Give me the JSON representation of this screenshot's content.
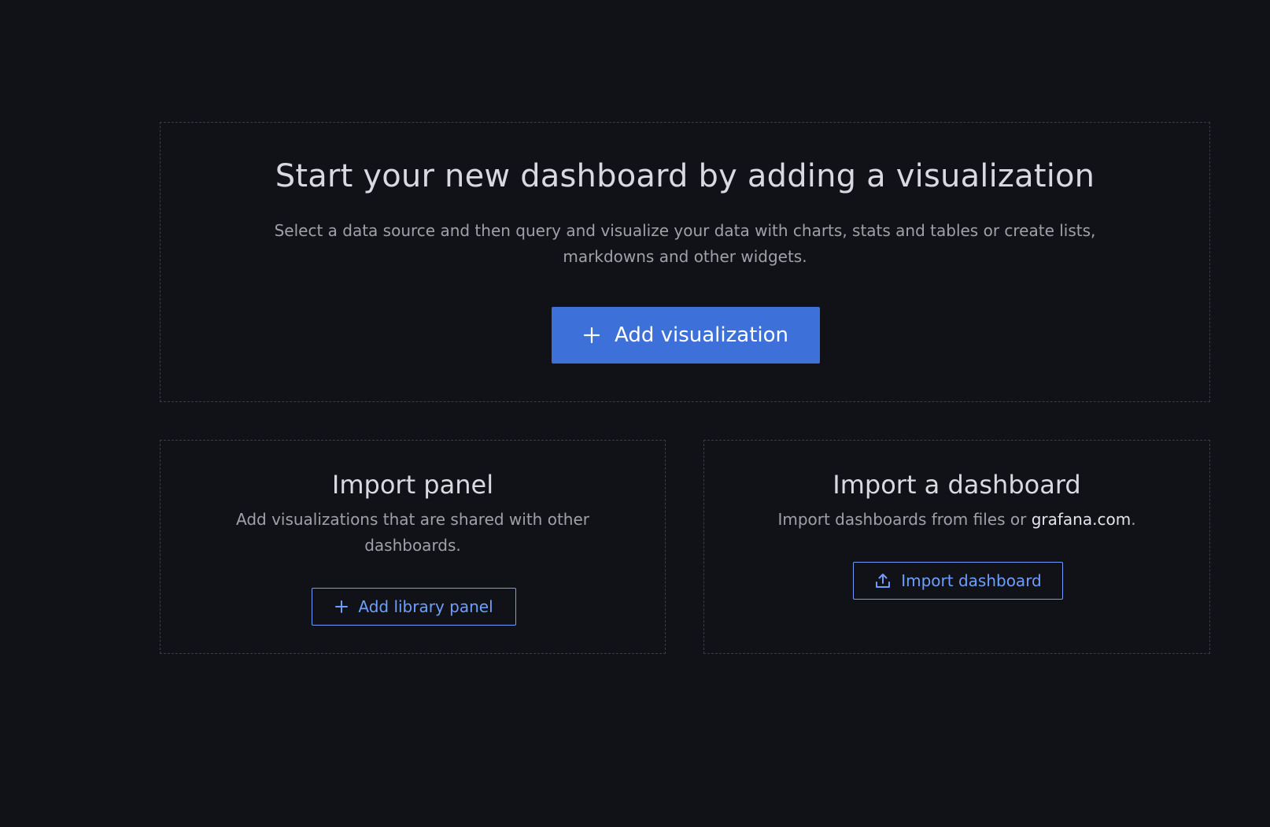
{
  "hero": {
    "title": "Start your new dashboard by adding a visualization",
    "description": "Select a data source and then query and visualize your data with charts, stats and tables or create lists, markdowns and other widgets.",
    "add_button_label": "Add visualization",
    "add_button_icon": "plus-icon"
  },
  "import_panel": {
    "title": "Import panel",
    "description": "Add visualizations that are shared with other dashboards.",
    "button_label": "Add library panel",
    "button_icon": "plus-icon"
  },
  "import_dashboard": {
    "title": "Import a dashboard",
    "description_prefix": "Import dashboards from files or ",
    "description_link": "grafana.com",
    "description_suffix": ".",
    "button_label": "Import dashboard",
    "button_icon": "upload-icon"
  },
  "colors": {
    "background": "#111217",
    "primary": "#3d71d9",
    "link_blue": "#6e9fff",
    "text": "#d8d9e1",
    "muted_text": "#9fa1a9"
  }
}
